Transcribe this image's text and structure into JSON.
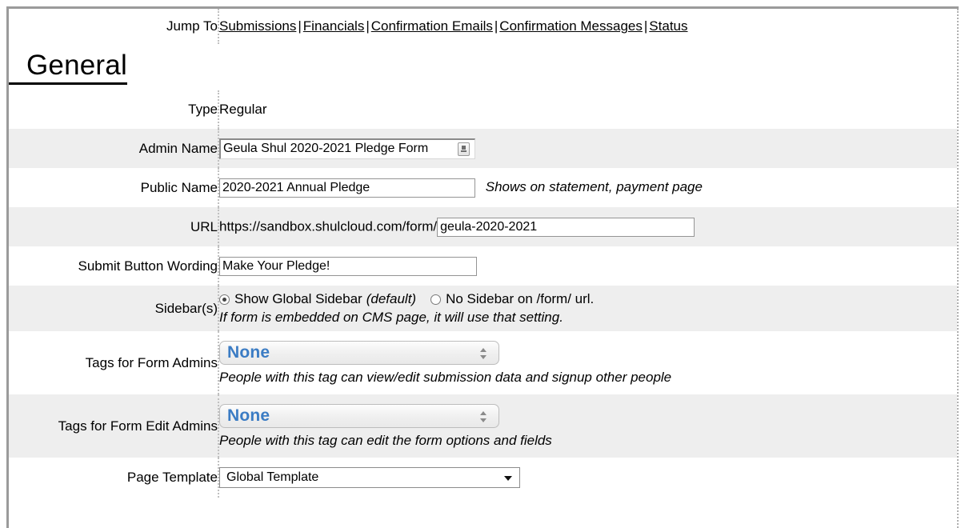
{
  "jump_to": {
    "label": "Jump To",
    "separator": "|",
    "links": [
      {
        "label": "Submissions"
      },
      {
        "label": "Financials"
      },
      {
        "label": "Confirmation Emails"
      },
      {
        "label": "Confirmation Messages"
      },
      {
        "label": "Status"
      }
    ]
  },
  "section": {
    "title": "General"
  },
  "fields": {
    "type": {
      "label": "Type",
      "value": "Regular"
    },
    "admin_name": {
      "label": "Admin Name",
      "value": "Geula Shul 2020-2021 Pledge Form",
      "placeholder": "",
      "spinner_icon": "spinner-icon"
    },
    "public_name": {
      "label": "Public Name",
      "value": "2020-2021 Annual Pledge",
      "placeholder": "",
      "hint": "Shows on statement, payment page"
    },
    "url": {
      "label": "URL",
      "prefix": "https://sandbox.shulcloud.com/form/",
      "value": "geula-2020-2021",
      "placeholder": ""
    },
    "submit_wording": {
      "label": "Submit Button Wording",
      "value": "Make Your Pledge!",
      "placeholder": ""
    },
    "sidebar": {
      "label": "Sidebar(s)",
      "options": [
        {
          "label": "Show Global Sidebar",
          "suffix": "(default)",
          "checked": true
        },
        {
          "label": "No Sidebar on /form/ url.",
          "suffix": "",
          "checked": false
        }
      ],
      "note": "If form is embedded on CMS page, it will use that setting."
    },
    "tags_form_admins": {
      "label": "Tags for Form Admins",
      "value": "None",
      "hint": "People with this tag can view/edit submission data and signup other people"
    },
    "tags_form_edit_admins": {
      "label": "Tags for Form Edit Admins",
      "value": "None",
      "hint": "People with this tag can edit the form options and fields"
    },
    "page_template": {
      "label": "Page Template",
      "value": "Global Template"
    }
  },
  "colors": {
    "stripe": "#eeeeee",
    "frame": "#9b9b9b",
    "select_text": "#3b7cc4",
    "divider": "#c0c0c0"
  }
}
